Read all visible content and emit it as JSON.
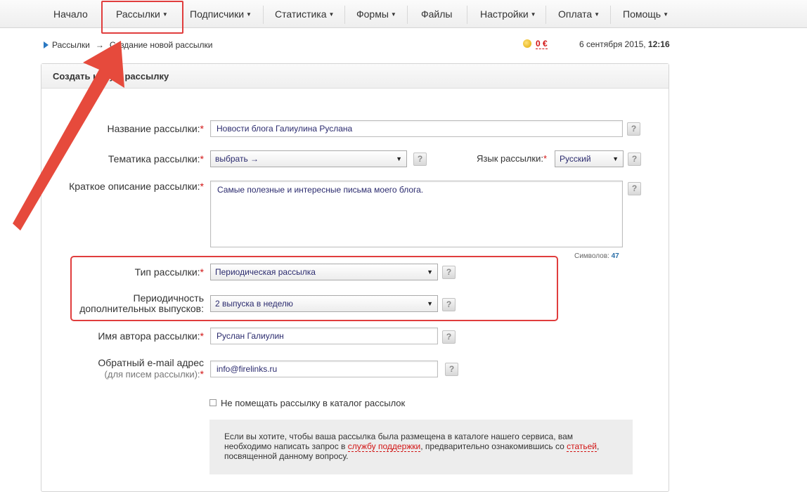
{
  "nav": {
    "items": [
      {
        "label": "Начало",
        "caret": false
      },
      {
        "label": "Рассылки",
        "caret": true
      },
      {
        "label": "Подписчики",
        "caret": true
      },
      {
        "label": "Статистика",
        "caret": true
      },
      {
        "label": "Формы",
        "caret": true
      },
      {
        "label": "Файлы",
        "caret": false
      },
      {
        "label": "Настройки",
        "caret": true
      },
      {
        "label": "Оплата",
        "caret": true
      },
      {
        "label": "Помощь",
        "caret": true
      }
    ]
  },
  "breadcrumb": {
    "root": "Рассылки",
    "arrow": "→",
    "current": "Создание новой рассылки"
  },
  "balance": {
    "value": "0 €"
  },
  "datetime": {
    "date": "6 сентября 2015,",
    "time": "12:16"
  },
  "panel": {
    "title": "Создать новую рассылку"
  },
  "form": {
    "name": {
      "label": "Название рассылки:",
      "value": "Новости блога Галиулина Руслана"
    },
    "topic": {
      "label": "Тематика рассылки:",
      "value": "выбрать →"
    },
    "language": {
      "label": "Язык рассылки:",
      "value": "Русский"
    },
    "description": {
      "label": "Краткое описание рассылки:",
      "value": "Самые полезные и интересные письма моего блога."
    },
    "counter": {
      "label": "Символов:",
      "value": "47"
    },
    "type": {
      "label": "Тип рассылки:",
      "value": "Периодическая рассылка"
    },
    "periodicity": {
      "label_line1": "Периодичность",
      "label_line2": "дополнительных выпусков:",
      "value": "2 выпуска в неделю"
    },
    "author": {
      "label": "Имя автора рассылки:",
      "value": "Руслан Галиулин"
    },
    "reply_email": {
      "label": "Обратный e-mail адрес",
      "sublabel": "(для писем рассылки):",
      "value": "info@firelinks.ru"
    },
    "required_mark": "*",
    "help_glyph": "?",
    "catalog_checkbox": {
      "label": "Не помещать рассылку в каталог рассылок",
      "checked": false
    }
  },
  "info": {
    "part1": "Если вы хотите, чтобы ваша рассылка была размещена в каталоге нашего сервиса, вам необходимо написать запрос в ",
    "link1": "службу поддержки",
    "part2": ", предварительно ознакомившись со ",
    "link2": "статьей",
    "part3": ", посвященной данному вопросу."
  },
  "icons": {
    "dropdown": "caret-down-icon",
    "breadcrumb": "triangle-right-icon",
    "balance": "coin-icon"
  },
  "colors": {
    "required": "#d21414",
    "annotation": "#e03d3d",
    "link": "#d21414",
    "value_text": "#2b2b6e"
  }
}
